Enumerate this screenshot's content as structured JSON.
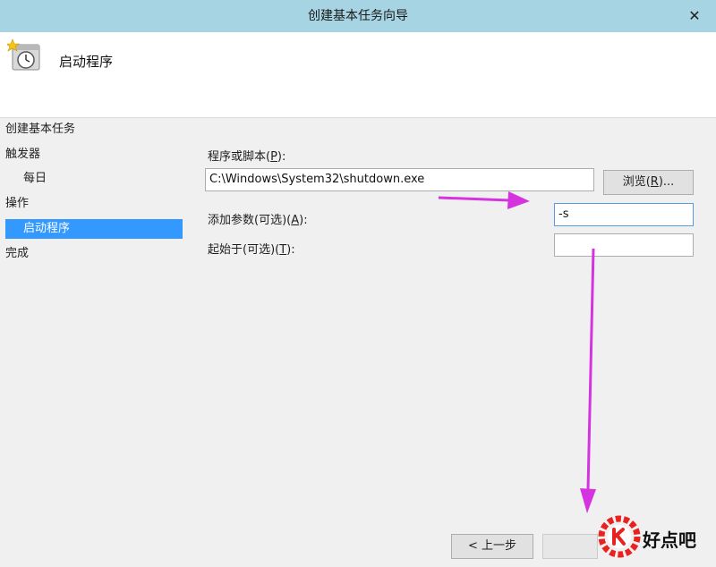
{
  "window": {
    "title": "创建基本任务向导",
    "close_glyph": "✕"
  },
  "header": {
    "title": "启动程序",
    "icon": "task-scheduler-clock-icon"
  },
  "steps": [
    {
      "label": "创建基本任务"
    },
    {
      "label": "触发器"
    },
    {
      "label": "每日"
    },
    {
      "label": "操作"
    },
    {
      "label": "启动程序"
    },
    {
      "label": "完成"
    }
  ],
  "form": {
    "program_label": {
      "text": "程序或脚本(",
      "key": "P",
      "tail": "):"
    },
    "program_value": "C:\\Windows\\System32\\shutdown.exe",
    "browse_button": {
      "text": "浏览(",
      "key": "R",
      "tail": ")..."
    },
    "args_label": {
      "text": "添加参数(可选)(",
      "key": "A",
      "tail": "):"
    },
    "args_value": "-s",
    "start_in_label": {
      "text": "起始于(可选)(",
      "key": "T",
      "tail": "):"
    },
    "start_in_value": ""
  },
  "footer": {
    "back_button": "< 上一步"
  },
  "watermark": {
    "text": "好点吧",
    "color": "#e8231f"
  },
  "annotation_color": "#d633e0"
}
